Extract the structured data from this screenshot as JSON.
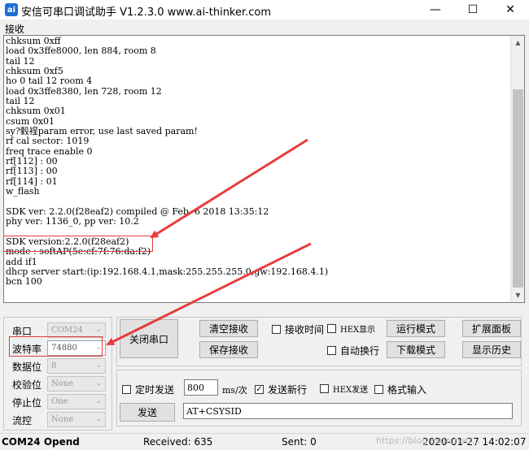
{
  "window": {
    "title": "安信可串口调试助手 V1.2.3.0    www.ai-thinker.com",
    "icon_text": "ai",
    "minimize_glyph": "—",
    "maximize_glyph": "☐",
    "close_glyph": "✕"
  },
  "receive": {
    "label": "接收",
    "lines": [
      "chksum 0xff",
      "load 0x3ffe8000, len 884, room 8",
      "tail 12",
      "chksum 0xf5",
      "ho 0 tail 12 room 4",
      "load 0x3ffe8380, len 728, room 12",
      "tail 12",
      "chksum 0x01",
      "csum 0x01",
      "sy?豰裎param error, use last saved param!",
      "rf cal sector: 1019",
      "freq trace enable 0",
      "rf[112] : 00",
      "rf[113] : 00",
      "rf[114] : 01",
      "w_flash",
      "",
      "SDK ver: 2.2.0(f28eaf2) compiled @ Feb  6 2018 13:35:12",
      "phy ver: 1136_0, pp ver: 10.2",
      "",
      "SDK version:2.2.0(f28eaf2)",
      "mode : softAP(5e:cf:7f:76:da:f2)",
      "add if1",
      "dhcp server start:(ip:192.168.4.1,mask:255.255.255.0,gw:192.168.4.1)",
      "bcn 100"
    ]
  },
  "settings": {
    "port_label": "串口",
    "port_value": "COM24",
    "baud_label": "波特率",
    "baud_value": "74880",
    "databits_label": "数据位",
    "databits_value": "8",
    "parity_label": "校验位",
    "parity_value": "None",
    "stopbits_label": "停止位",
    "stopbits_value": "One",
    "flow_label": "流控",
    "flow_value": "None"
  },
  "controls": {
    "close_port": "关闭串口",
    "clear_recv": "清空接收",
    "save_recv": "保存接收",
    "recv_time": "接收时间",
    "hex_display": "HEX显示",
    "auto_wrap": "自动换行",
    "run_mode": "运行模式",
    "download_mode": "下载模式",
    "expand_panel": "扩展面板",
    "show_history": "显示历史"
  },
  "send": {
    "timed_send": "定时发送",
    "interval_value": "800",
    "interval_unit": "ms/次",
    "send_newline": "发送新行",
    "hex_send": "HEX发送",
    "format_input": "格式输入",
    "send_button": "发送",
    "send_text": "AT+CSYSID"
  },
  "checks": {
    "recv_time": false,
    "hex_display": false,
    "auto_wrap": false,
    "timed_send": false,
    "send_newline": true,
    "hex_send": false,
    "format_input": false
  },
  "status": {
    "port": "COM24 Opend",
    "received": "Received: 635",
    "sent": "Sent: 0",
    "datetime": "2020-01-27 14:02:07"
  },
  "watermark": "https://blog.csdn.net/...",
  "colors": {
    "annotation_red": "#e63c3c",
    "icon_blue": "#1a6fd1"
  }
}
